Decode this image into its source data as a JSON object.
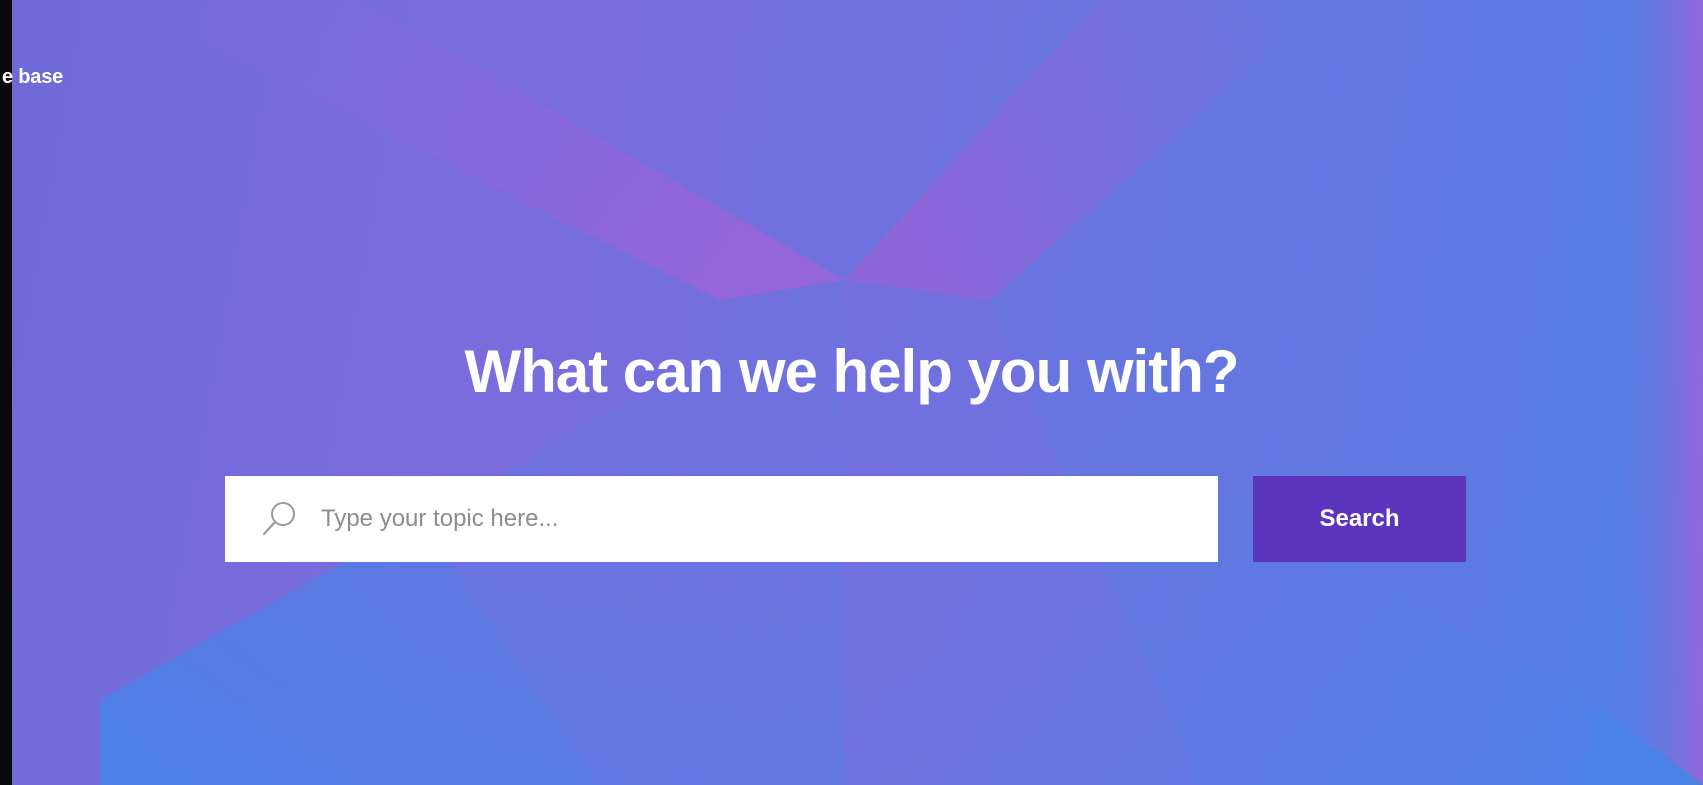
{
  "header": {
    "kb_link_label": "e base"
  },
  "hero": {
    "title": "What can we help you with?"
  },
  "search": {
    "placeholder": "Type your topic here...",
    "value": "",
    "button_label": "Search",
    "icon": "search-icon"
  },
  "colors": {
    "background_gradient": [
      "#6f6ad8",
      "#8f66d8",
      "#4a82e6"
    ],
    "search_button_bg": "#5b35bd",
    "title_text": "#ffffff",
    "left_edge": "#0a0a0a"
  }
}
